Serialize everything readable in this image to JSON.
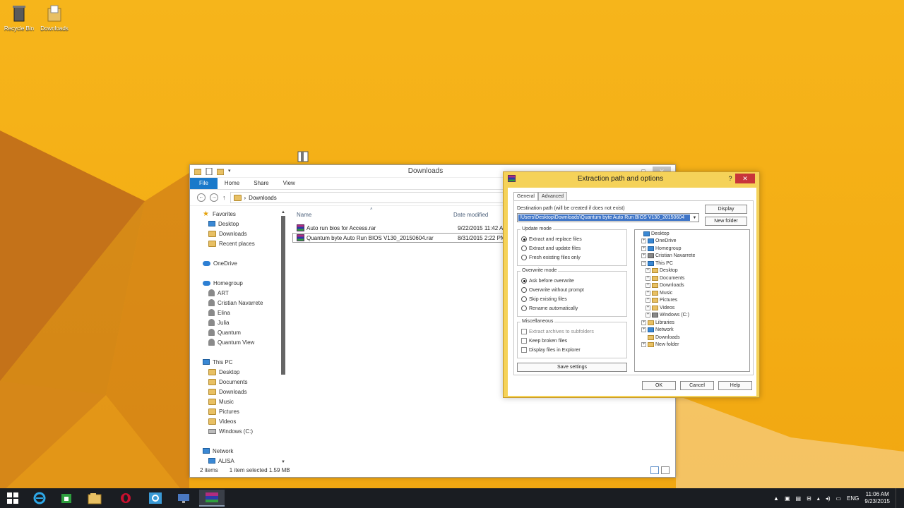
{
  "desktop": {
    "icons": [
      {
        "label": "Recycle Bin",
        "icon": "recycle-bin-icon"
      },
      {
        "label": "Downloads",
        "icon": "folder-icon"
      }
    ]
  },
  "explorer": {
    "title": "Downloads",
    "tabs": [
      "File",
      "Home",
      "Share",
      "View"
    ],
    "address": {
      "crumb_sep": "›",
      "path": "Downloads"
    },
    "nav": {
      "favorites": {
        "label": "Favorites",
        "items": [
          "Desktop",
          "Downloads",
          "Recent places"
        ]
      },
      "onedrive": "OneDrive",
      "homegroup": {
        "label": "Homegroup",
        "items": [
          "ART",
          "Cristian Navarrete",
          "Elina",
          "Julia",
          "Quantum",
          "Quantum View"
        ]
      },
      "thispc": {
        "label": "This PC",
        "items": [
          "Desktop",
          "Documents",
          "Downloads",
          "Music",
          "Pictures",
          "Videos",
          "Windows (C:)"
        ]
      },
      "network": {
        "label": "Network",
        "items": [
          "ALISA"
        ]
      }
    },
    "columns": {
      "name": "Name",
      "date": "Date modified"
    },
    "files": [
      {
        "name": "Auto run bios for Access.rar",
        "date": "9/22/2015 11:42 AM",
        "selected": false
      },
      {
        "name": "Quantum byte Auto Run BIOS V130_20150604.rar",
        "date": "8/31/2015 2:22 PM",
        "selected": true
      }
    ],
    "status": {
      "count": "2 items",
      "selection": "1 item selected  1.59 MB"
    }
  },
  "dialog": {
    "title": "Extraction path and options",
    "help": "?",
    "close": "✕",
    "tabs": [
      "General",
      "Advanced"
    ],
    "dest_label": "Destination path (will be created if does not exist)",
    "dest_value": "\\Users\\Desktop\\Downloads\\Quantum byte Auto Run BIOS V130_20150604",
    "display_button": "Display",
    "new_folder_button": "New folder",
    "update_mode": {
      "title": "Update mode",
      "options": [
        "Extract and replace files",
        "Extract and update files",
        "Fresh existing files only"
      ],
      "selected": 0
    },
    "overwrite_mode": {
      "title": "Overwrite mode",
      "options": [
        "Ask before overwrite",
        "Overwrite without prompt",
        "Skip existing files",
        "Rename automatically"
      ],
      "selected": 0
    },
    "misc": {
      "title": "Miscellaneous",
      "options": [
        "Extract archives to subfolders",
        "Keep broken files",
        "Display files in Explorer"
      ]
    },
    "save_settings": "Save settings",
    "tree": [
      {
        "label": "Desktop",
        "level": 0,
        "exp": "",
        "icon": "blue"
      },
      {
        "label": "OneDrive",
        "level": 1,
        "exp": "+",
        "icon": "blue"
      },
      {
        "label": "Homegroup",
        "level": 1,
        "exp": "+",
        "icon": "blue"
      },
      {
        "label": "Cristian Navarrete",
        "level": 1,
        "exp": "+",
        "icon": "gray"
      },
      {
        "label": "This PC",
        "level": 1,
        "exp": "−",
        "icon": "blue"
      },
      {
        "label": "Desktop",
        "level": 2,
        "exp": "+",
        "icon": "yellow"
      },
      {
        "label": "Documents",
        "level": 2,
        "exp": "+",
        "icon": "yellow"
      },
      {
        "label": "Downloads",
        "level": 2,
        "exp": "+",
        "icon": "yellow"
      },
      {
        "label": "Music",
        "level": 2,
        "exp": "+",
        "icon": "yellow"
      },
      {
        "label": "Pictures",
        "level": 2,
        "exp": "+",
        "icon": "yellow"
      },
      {
        "label": "Videos",
        "level": 2,
        "exp": "+",
        "icon": "yellow"
      },
      {
        "label": "Windows (C:)",
        "level": 2,
        "exp": "+",
        "icon": "gray"
      },
      {
        "label": "Libraries",
        "level": 1,
        "exp": "+",
        "icon": "yellow"
      },
      {
        "label": "Network",
        "level": 1,
        "exp": "+",
        "icon": "blue"
      },
      {
        "label": "Downloads",
        "level": 1,
        "exp": "",
        "icon": "yellow"
      },
      {
        "label": "New folder",
        "level": 1,
        "exp": "+",
        "icon": "yellow"
      }
    ],
    "buttons": {
      "ok": "OK",
      "cancel": "Cancel",
      "help": "Help"
    }
  },
  "taskbar": {
    "apps": [
      "start",
      "internet-explorer",
      "store",
      "file-explorer",
      "opera",
      "network-app",
      "remote-app",
      "winrar"
    ],
    "tray": {
      "lang": "ENG",
      "time": "11:06 AM",
      "date": "9/23/2015"
    }
  },
  "colors": {
    "accent": "#1979ca",
    "dialog_frame": "#f5d259",
    "desktop": "#f4ad14"
  }
}
